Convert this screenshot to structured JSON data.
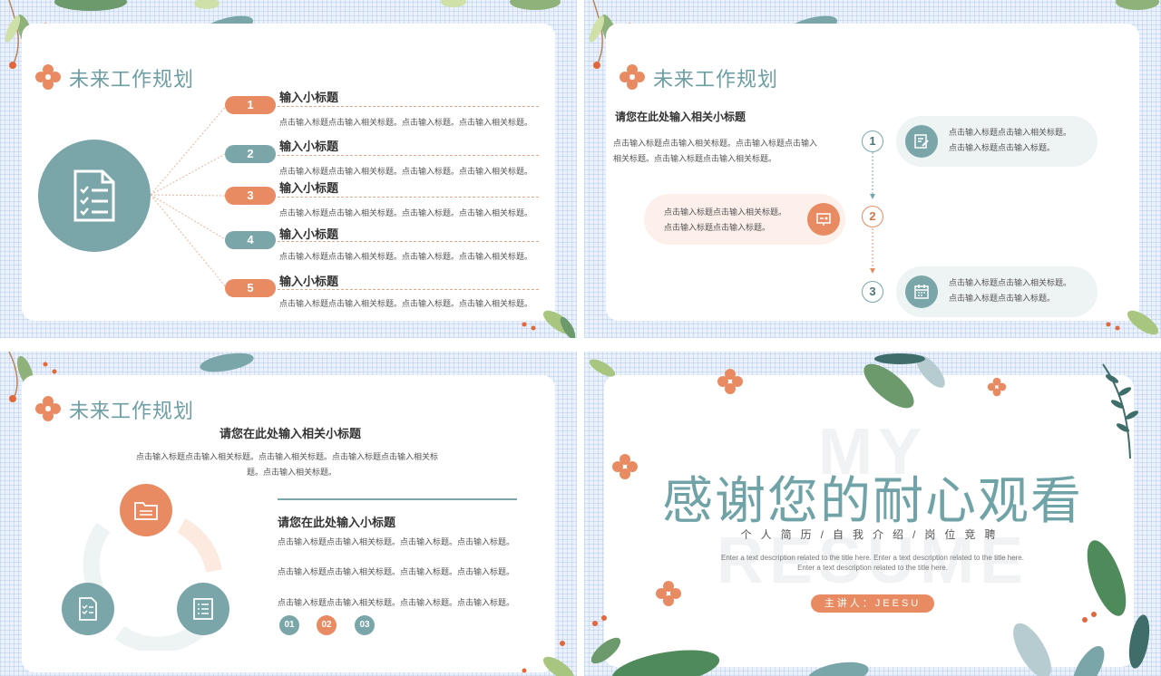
{
  "colors": {
    "teal": "#7aa6aa",
    "orange": "#e98b62",
    "title_teal": "#6c9ea4"
  },
  "slide1": {
    "title": "未来工作规划",
    "items": [
      {
        "num": "1",
        "title": "输入小标题",
        "desc": "点击输入标题点击输入相关标题。点击输入标题。点击输入相关标题。"
      },
      {
        "num": "2",
        "title": "输入小标题",
        "desc": "点击输入标题点击输入相关标题。点击输入标题。点击输入相关标题。"
      },
      {
        "num": "3",
        "title": "输入小标题",
        "desc": "点击输入标题点击输入相关标题。点击输入标题。点击输入相关标题。"
      },
      {
        "num": "4",
        "title": "输入小标题",
        "desc": "点击输入标题点击输入相关标题。点击输入标题。点击输入相关标题。"
      },
      {
        "num": "5",
        "title": "输入小标题",
        "desc": "点击输入标题点击输入相关标题。点击输入标题。点击输入相关标题。"
      }
    ],
    "icon": "document-checklist-icon"
  },
  "slide2": {
    "title": "未来工作规划",
    "subtitle": "请您在此处输入相关小标题",
    "desc_line1": "点击输入标题点击输入相关标题。点击输入标题点击输入",
    "desc_line2": "相关标题。点击输入标题点击输入相关标题。",
    "steps": [
      "1",
      "2",
      "3"
    ],
    "bubbles": [
      {
        "line1": "点击输入标题点击输入相关标题。",
        "line2": "点击输入标题点击输入标题。",
        "icon": "edit-icon"
      },
      {
        "line1": "点击输入标题点击输入相关标题。",
        "line2": "点击输入标题点击输入标题。",
        "icon": "presentation-icon"
      },
      {
        "line1": "点击输入标题点击输入相关标题。",
        "line2": "点击输入标题点击输入标题。",
        "icon": "calendar-icon"
      }
    ]
  },
  "slide3": {
    "title": "未来工作规划",
    "subtitle": "请您在此处输入相关小标题",
    "desc_line1": "点击输入标题点击输入相关标题。点击输入相关标题。点击输入标题点击输入相关标",
    "desc_line2": "题。点击输入相关标题。",
    "subtitle2": "请您在此处输入小标题",
    "paragraphs": [
      "点击输入标题点击输入相关标题。点击输入标题。点击输入标题。",
      "点击输入标题点击输入相关标题。点击输入标题。点击输入标题。",
      "点击输入标题点击输入相关标题。点击输入标题。点击输入标题。"
    ],
    "nums": [
      "01",
      "02",
      "03"
    ]
  },
  "slide4": {
    "bg_word1": "MY",
    "bg_word2": "RESUME",
    "title": "感谢您的耐心观看",
    "subtitle": "个人简历/自我介绍/岗位竞聘",
    "desc_line1": "Enter a text description related to the title here. Enter a text description related to the title here.",
    "desc_line2": "Enter a text description related to the title here.",
    "presenter": "主讲人：JEESU"
  }
}
